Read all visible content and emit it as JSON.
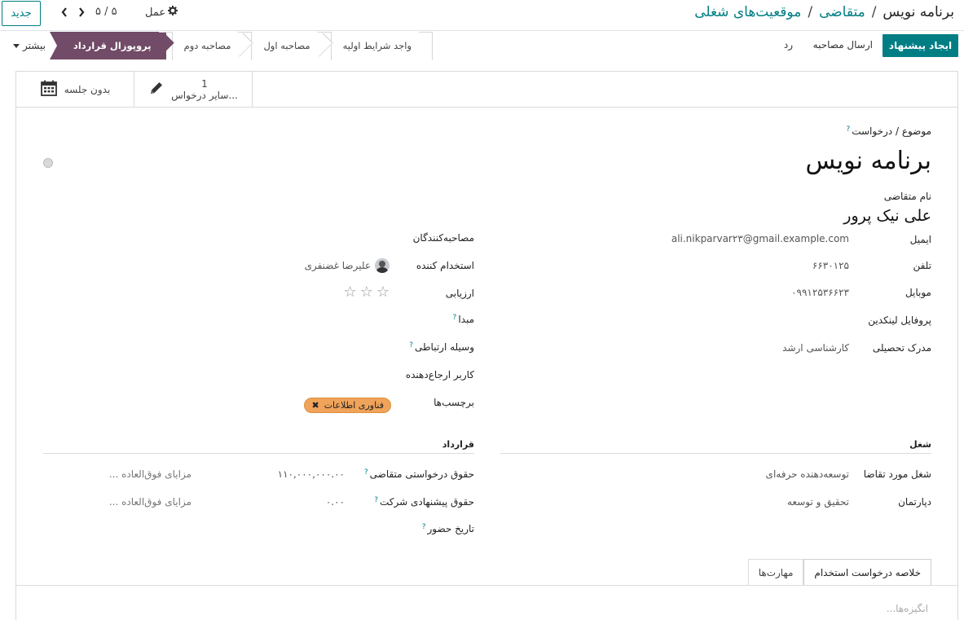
{
  "topbar": {
    "new_label": "جدید",
    "pager_value": "۵ / ۵",
    "action_label": "عمل",
    "breadcrumb": [
      "موقعیت‌های شغلی",
      "متقاضی",
      "برنامه نویس"
    ]
  },
  "statusbar": {
    "primary_button": "ایجاد پیشنهاد",
    "send_interview": "ارسال مصاحبه",
    "refuse": "رد",
    "more": "بیشتر",
    "stages": [
      "پروپوزال قرارداد",
      "مصاحبه دوم",
      "مصاحبه اول",
      "واجد شرایط اولیه"
    ],
    "active_stage": "پروپوزال قرارداد"
  },
  "button_box": {
    "meetings_label": "بدون جلسه",
    "other_applications_count": "1",
    "other_applications_label": "سایر درخواس..."
  },
  "form": {
    "subject_label": "موضوع / درخواست",
    "subject_value": "برنامه نویس",
    "applicant_name_label": "نام متقاضی",
    "applicant_name": "علی نیک پرور",
    "left_fields": {
      "email_label": "ایمیل",
      "email_value": "ali.nikparvar۲۳@gmail.example.com",
      "phone_label": "تلفن",
      "phone_value": "۶۶۳۰۱۲۵",
      "mobile_label": "موبایل",
      "mobile_value": "۰۹۹۱۲۵۳۶۶۲۳",
      "linkedin_label": "پروفایل لینکدین",
      "degree_label": "مدرک تحصیلی",
      "degree_value": "کارشناسی ارشد"
    },
    "right_fields": {
      "interviewers_label": "مصاحبه‌کنندگان",
      "recruiter_label": "استخدام کننده",
      "recruiter_value": "علیرضا غضنفری",
      "evaluation_label": "ارزیابی",
      "evaluation_stars": 0,
      "source_label": "مبدا",
      "medium_label": "وسیله ارتباطی",
      "referrer_label": "کاربر ارجاع‌دهنده",
      "tags_label": "برچسب‌ها",
      "tags": [
        "فناوری اطلاعات"
      ]
    },
    "job_section": {
      "title": "شغل",
      "applied_job_label": "شغل مورد تقاضا",
      "applied_job_value": "توسعه‌دهنده حرفه‌ای",
      "department_label": "دپارتمان",
      "department_value": "تحقیق و توسعه"
    },
    "contract_section": {
      "title": "قرارداد",
      "expected_salary_label": "حقوق درخواستی متقاضی",
      "expected_salary_value": "۱۱۰,۰۰۰,۰۰۰.۰۰",
      "expected_extra_placeholder": "مزایای فوق‌العاده ...",
      "proposed_salary_label": "حقوق پیشنهادی شرکت",
      "proposed_salary_value": "۰.۰۰",
      "proposed_extra_placeholder": "مزایای فوق‌العاده ...",
      "availability_label": "تاریخ حضور"
    },
    "tabs": [
      "خلاصه درخواست استخدام",
      "مهارت‌ها"
    ],
    "active_tab": "خلاصه درخواست استخدام",
    "motivation_placeholder": "انگیزه‌ها..."
  },
  "colors": {
    "primary": "#017e84",
    "active_stage": "#714b67",
    "tag": "#f0a35a"
  }
}
